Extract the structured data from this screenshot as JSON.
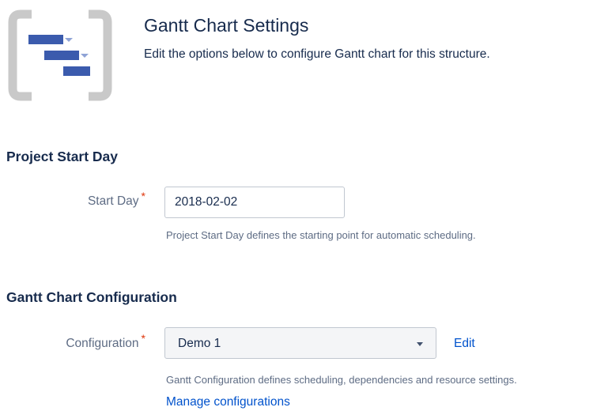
{
  "header": {
    "title": "Gantt Chart Settings",
    "description": "Edit the options below to configure Gantt chart for this structure.",
    "logo_icon": "gantt-chart-icon"
  },
  "sections": {
    "start_day": {
      "heading": "Project Start Day",
      "label": "Start Day",
      "required_mark": "*",
      "value": "2018-02-02",
      "helper": "Project Start Day defines the starting point for automatic scheduling."
    },
    "configuration": {
      "heading": "Gantt Chart Configuration",
      "label": "Configuration",
      "required_mark": "*",
      "selected": "Demo 1",
      "edit_label": "Edit",
      "helper": "Gantt Configuration defines scheduling, dependencies and resource settings.",
      "manage_label": "Manage configurations"
    }
  },
  "colors": {
    "link": "#0052cc",
    "required": "#de350b",
    "gantt_bar": "#3b5bad",
    "logo_frame": "#c9c9c9"
  }
}
